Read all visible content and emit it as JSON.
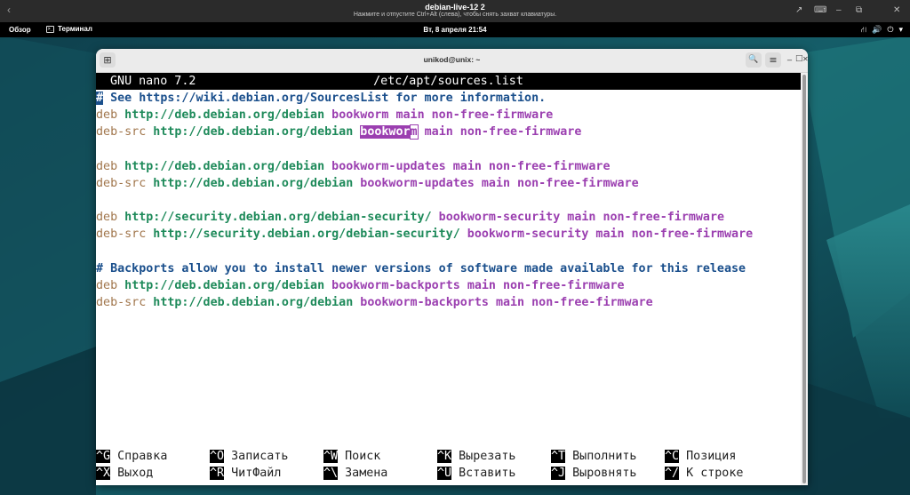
{
  "vm_header": {
    "back_icon": "‹",
    "title": "debian-live-12 2",
    "subtitle": "Нажмите и отпустите Ctrl+Alt (слева), чтобы снять захват клавиатуры.",
    "controls": [
      "↗",
      "⌨",
      "–",
      "⧉",
      "✕"
    ]
  },
  "top_bar": {
    "activities": "Обзор",
    "app_name": "Терминал",
    "clock": "Вт, 8 апреля  21:54",
    "tray_icons": [
      "⛙",
      "🔊",
      "⏻",
      "▾"
    ]
  },
  "terminal": {
    "title": "unikod@unix: ~",
    "new_tab_icon": "⊞",
    "search_icon": "🔍",
    "menu_icon": "≡",
    "minimize_icon": "_",
    "maximize_icon": "□",
    "close_icon": "✕",
    "nano": {
      "version": "GNU nano 7.2",
      "filename": "/etc/apt/sources.list",
      "comment1_hash": "#",
      "comment1_rest": " See https://wiki.debian.org/SourcesList for more information.",
      "lines": [
        {
          "type": "deb",
          "url": "http://deb.debian.org/debian",
          "suite": "bookworm",
          "components": "main non-free-firmware"
        },
        {
          "type": "deb-src",
          "url": "http://deb.debian.org/debian",
          "suite_sel": "bookwor",
          "suite_rest": "m",
          "components": "main non-free-firmware"
        },
        {
          "type": "deb",
          "url": "http://deb.debian.org/debian",
          "suite": "bookworm-updates",
          "components": "main non-free-firmware"
        },
        {
          "type": "deb-src",
          "url": "http://deb.debian.org/debian",
          "suite": "bookworm-updates",
          "components": "main non-free-firmware"
        },
        {
          "type": "deb",
          "url": "http://security.debian.org/debian-security/",
          "suite": "bookworm-security",
          "components": "main non-free-firmware"
        },
        {
          "type": "deb-src",
          "url": "http://security.debian.org/debian-security/",
          "suite": "bookworm-security",
          "components": "main non-free-firmware"
        },
        {
          "type": "deb",
          "url": "http://deb.debian.org/debian",
          "suite": "bookworm-backports",
          "components": "main non-free-firmware"
        },
        {
          "type": "deb-src",
          "url": "http://deb.debian.org/debian",
          "suite": "bookworm-backports",
          "components": "main non-free-firmware"
        }
      ],
      "comment2": "# Backports allow you to install newer versions of software made available for this release",
      "shortcuts_row1": [
        {
          "key": "^G",
          "label": "Справка"
        },
        {
          "key": "^O",
          "label": "Записать"
        },
        {
          "key": "^W",
          "label": "Поиск"
        },
        {
          "key": "^K",
          "label": "Вырезать"
        },
        {
          "key": "^T",
          "label": "Выполнить"
        },
        {
          "key": "^C",
          "label": "Позиция"
        }
      ],
      "shortcuts_row2": [
        {
          "key": "^X",
          "label": "Выход"
        },
        {
          "key": "^R",
          "label": "ЧитФайл"
        },
        {
          "key": "^\\",
          "label": "Замена"
        },
        {
          "key": "^U",
          "label": "Вставить"
        },
        {
          "key": "^J",
          "label": "Выровнять"
        },
        {
          "key": "^/",
          "label": "К строке"
        }
      ]
    }
  },
  "colors": {
    "desktop_dark": "#0b2e3a",
    "desktop_teal": "#1f6e78",
    "comment": "#1a4f8c",
    "deb_keyword": "#a1764c",
    "url": "#1e8a5a",
    "suite": "#9b3fb0"
  }
}
